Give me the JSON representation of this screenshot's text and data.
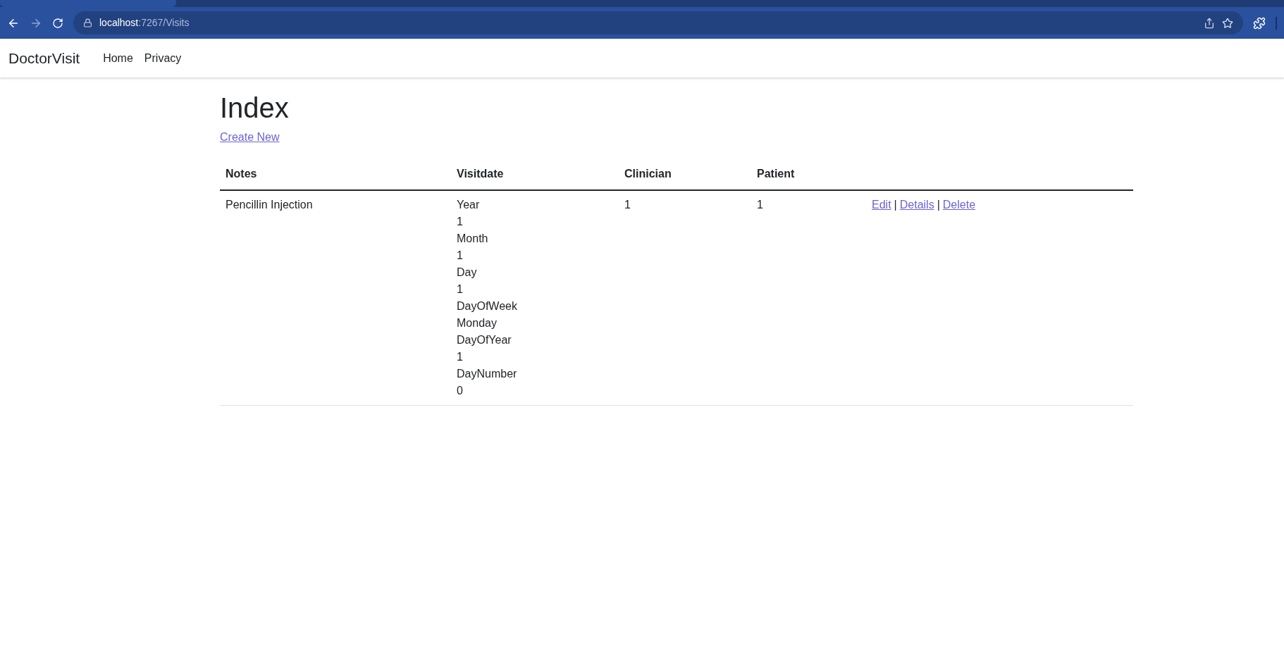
{
  "browser": {
    "url_host": "localhost",
    "url_path": ":7267/Visits"
  },
  "navbar": {
    "brand": "DoctorVisit",
    "links": [
      "Home",
      "Privacy"
    ]
  },
  "page": {
    "title": "Index",
    "create_link": "Create New"
  },
  "table": {
    "columns": [
      "Notes",
      "Visitdate",
      "Clinician",
      "Patient"
    ],
    "rows": [
      {
        "notes": "Pencillin Injection",
        "visitdate": [
          "Year",
          "1",
          "Month",
          "1",
          "Day",
          "1",
          "DayOfWeek",
          "Monday",
          "DayOfYear",
          "1",
          "DayNumber",
          "0"
        ],
        "clinician": "1",
        "patient": "1",
        "actions": [
          "Edit",
          "Details",
          "Delete"
        ],
        "separator": "|"
      }
    ]
  }
}
